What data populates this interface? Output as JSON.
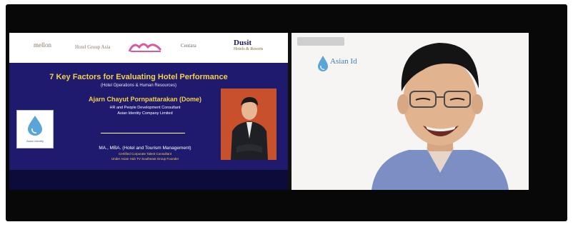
{
  "slide": {
    "logos": {
      "logo1": "mellon",
      "logo2": "Hotel Group Asia",
      "logo4": "Centara",
      "logo5": "Dusit",
      "logo5_sub": "Hotels & Resorts"
    },
    "title": "7 Key Factors for Evaluating Hotel Performance",
    "subtitle": "(Hotel Operations & Human Resources)",
    "speaker_name": "Ajarn Chayut Pornpattarakan (Dome)",
    "speaker_roles": [
      "HR and People Development Consultant",
      "Asian Identity Company Limited",
      ""
    ],
    "degree": "MA., MBA. (Hotel and Tourism Management)",
    "degree_sub": [
      "Certified Corporate Talent Consultant",
      "Under Asian Hub TV Southeast Group Founder"
    ],
    "brand_caption": "Asian Identity"
  },
  "camera": {
    "logo_text": "Asian Identity"
  },
  "colors": {
    "slide_bg": "#1e1a6e",
    "slide_title": "#f6d04a",
    "photo_bg": "#c8502a",
    "brand_blue": "#3f7fb0"
  }
}
